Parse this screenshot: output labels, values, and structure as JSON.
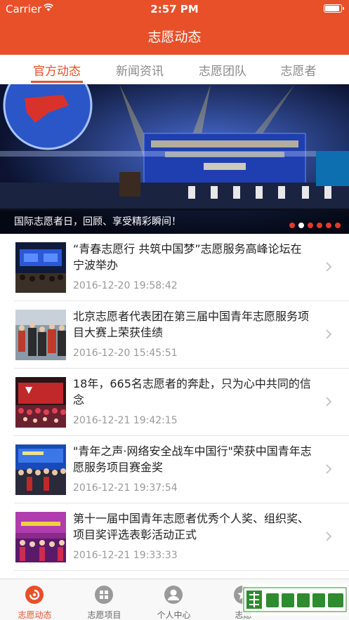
{
  "status_bar": {
    "carrier": "Carrier",
    "time": "2:57 PM"
  },
  "nav": {
    "title": "志愿动态"
  },
  "tabs": [
    {
      "label": "官方动态",
      "active": true
    },
    {
      "label": "新闻资讯",
      "active": false
    },
    {
      "label": "志愿团队",
      "active": false
    },
    {
      "label": "志愿者",
      "active": false
    }
  ],
  "banner": {
    "caption": "国际志愿者日，回顾、享受精彩瞬间！",
    "slide_count": 6,
    "active_slide": 1
  },
  "news": [
    {
      "title": "“青春志愿行 共筑中国梦”志愿服务高峰论坛在宁波举办",
      "date": "2016-12-20 19:58:42"
    },
    {
      "title": "北京志愿者代表团在第三届中国青年志愿服务项目大赛上荣获佳绩",
      "date": "2016-12-20 15:45:51"
    },
    {
      "title": "18年，665名志愿者的奔赴，只为心中共同的信念",
      "date": "2016-12-21 19:42:15"
    },
    {
      "title": "\"青年之声·网络安全战车中国行\"荣获中国青年志愿服务项目赛金奖",
      "date": "2016-12-21 19:37:54"
    },
    {
      "title": "第十一届中国青年志愿者优秀个人奖、组织奖、项目奖评选表彰活动正式",
      "date": "2016-12-21 19:33:33"
    }
  ],
  "tabbar": [
    {
      "label": "志愿动态",
      "icon": "volunteer-news-icon",
      "active": true
    },
    {
      "label": "志愿项目",
      "icon": "grid-icon",
      "active": false
    },
    {
      "label": "个人中心",
      "icon": "user-icon",
      "active": false
    },
    {
      "label": "志愿",
      "icon": "star-icon",
      "active": false
    }
  ],
  "colors": {
    "brand": "#e8502a",
    "text": "#222222",
    "muted": "#999999"
  }
}
